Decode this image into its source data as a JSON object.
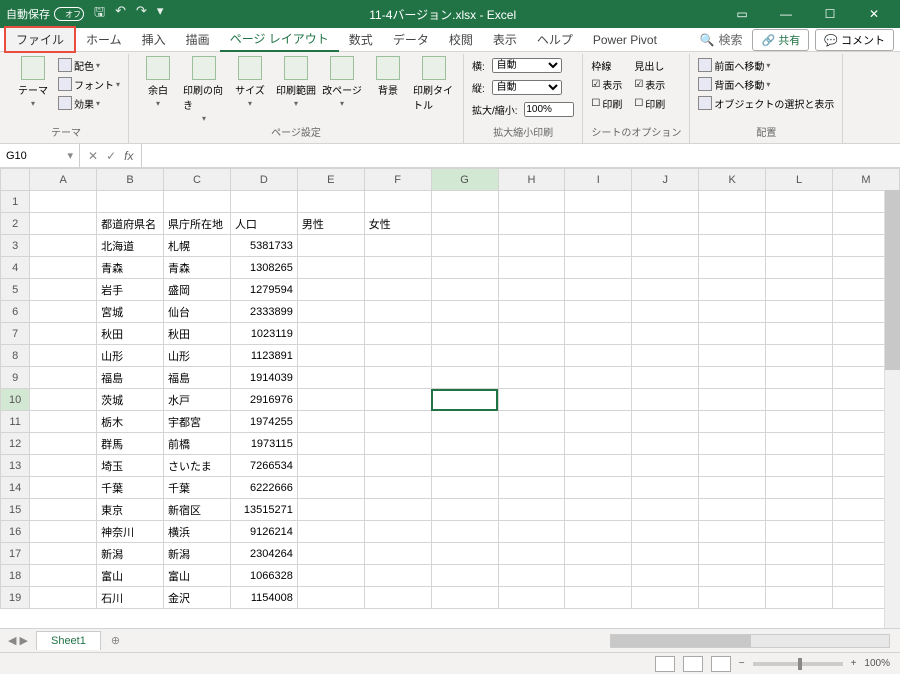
{
  "titlebar": {
    "autosave_label": "自動保存",
    "autosave_state": "オフ",
    "title": "11-4バージョン.xlsx - Excel"
  },
  "tabs": {
    "file": "ファイル",
    "home": "ホーム",
    "insert": "挿入",
    "draw": "描画",
    "pagelayout": "ページ レイアウト",
    "formulas": "数式",
    "data": "データ",
    "review": "校閲",
    "view": "表示",
    "help": "ヘルプ",
    "powerpivot": "Power Pivot",
    "search": "検索",
    "share": "共有",
    "comment": "コメント"
  },
  "ribbon": {
    "themes": {
      "label": "テーマ",
      "theme_btn": "テーマ",
      "colors": "配色",
      "fonts": "フォント",
      "effects": "効果"
    },
    "pagesetup": {
      "label": "ページ設定",
      "margins": "余白",
      "orientation": "印刷の向き",
      "size": "サイズ",
      "printarea": "印刷範囲",
      "breaks": "改ページ",
      "background": "背景",
      "printtitles": "印刷タイトル"
    },
    "scalefit": {
      "label": "拡大縮小印刷",
      "width": "横:",
      "height": "縦:",
      "scale": "拡大/縮小:",
      "auto": "自動",
      "pct": "100%"
    },
    "sheetopt": {
      "label": "シートのオプション",
      "gridlines": "枠線",
      "headings": "見出し",
      "view": "表示",
      "print": "印刷"
    },
    "arrange": {
      "label": "配置",
      "forward": "前面へ移動",
      "backward": "背面へ移動",
      "selection": "オブジェクトの選択と表示"
    }
  },
  "formula": {
    "namebox": "G10"
  },
  "columns": [
    "A",
    "B",
    "C",
    "D",
    "E",
    "F",
    "G",
    "H",
    "I",
    "J",
    "K",
    "L",
    "M"
  ],
  "headers": {
    "pref": "都道府県名",
    "capital": "県庁所在地",
    "pop": "人口",
    "male": "男性",
    "female": "女性"
  },
  "rows": [
    {
      "n": 1
    },
    {
      "n": 2,
      "header": true
    },
    {
      "n": 3,
      "pref": "北海道",
      "cap": "札幌",
      "pop": "5381733"
    },
    {
      "n": 4,
      "pref": "青森",
      "cap": "青森",
      "pop": "1308265"
    },
    {
      "n": 5,
      "pref": "岩手",
      "cap": "盛岡",
      "pop": "1279594"
    },
    {
      "n": 6,
      "pref": "宮城",
      "cap": "仙台",
      "pop": "2333899"
    },
    {
      "n": 7,
      "pref": "秋田",
      "cap": "秋田",
      "pop": "1023119"
    },
    {
      "n": 8,
      "pref": "山形",
      "cap": "山形",
      "pop": "1123891"
    },
    {
      "n": 9,
      "pref": "福島",
      "cap": "福島",
      "pop": "1914039"
    },
    {
      "n": 10,
      "pref": "茨城",
      "cap": "水戸",
      "pop": "2916976"
    },
    {
      "n": 11,
      "pref": "栃木",
      "cap": "宇都宮",
      "pop": "1974255"
    },
    {
      "n": 12,
      "pref": "群馬",
      "cap": "前橋",
      "pop": "1973115"
    },
    {
      "n": 13,
      "pref": "埼玉",
      "cap": "さいたま",
      "pop": "7266534"
    },
    {
      "n": 14,
      "pref": "千葉",
      "cap": "千葉",
      "pop": "6222666"
    },
    {
      "n": 15,
      "pref": "東京",
      "cap": "新宿区",
      "pop": "13515271"
    },
    {
      "n": 16,
      "pref": "神奈川",
      "cap": "横浜",
      "pop": "9126214"
    },
    {
      "n": 17,
      "pref": "新潟",
      "cap": "新潟",
      "pop": "2304264"
    },
    {
      "n": 18,
      "pref": "富山",
      "cap": "富山",
      "pop": "1066328"
    },
    {
      "n": 19,
      "pref": "石川",
      "cap": "金沢",
      "pop": "1154008"
    }
  ],
  "sheettab": "Sheet1",
  "status": {
    "zoom": "100%"
  },
  "selected_cell": "G10"
}
